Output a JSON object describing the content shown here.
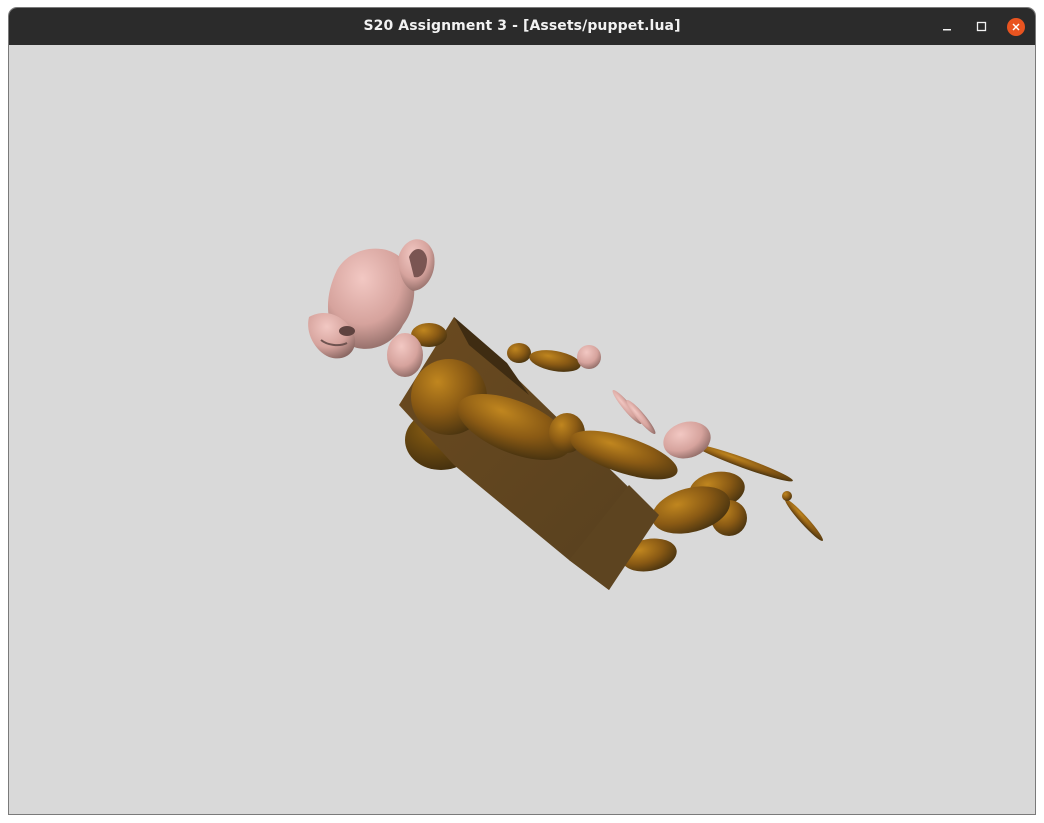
{
  "window": {
    "title": "S20 Assignment 3 - [Assets/puppet.lua]",
    "controls": {
      "minimize_icon": "minimize-icon",
      "maximize_icon": "maximize-icon",
      "close_icon": "close-icon"
    }
  },
  "viewport": {
    "background_color": "#d9d9d9",
    "scene": "puppet",
    "colors": {
      "body": "#8a5a17",
      "body_dark": "#5e4220",
      "skin": "#d8a8a2",
      "skin_shadow": "#8f6d6a"
    }
  },
  "theme": {
    "titlebar_bg": "#2b2b2b",
    "close_button": "#e95420"
  }
}
